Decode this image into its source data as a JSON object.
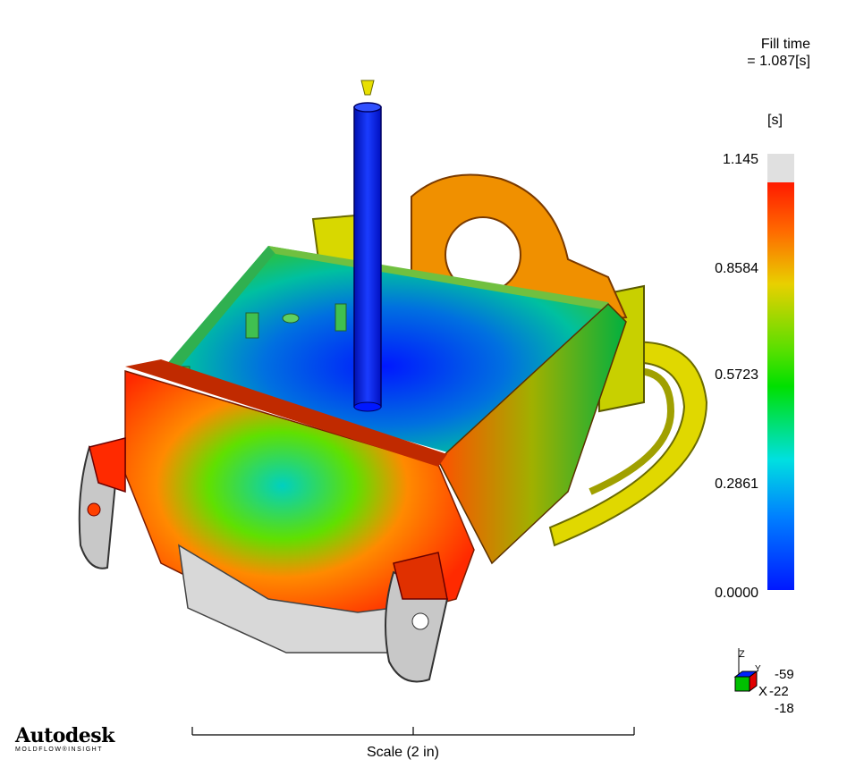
{
  "result": {
    "title_line1": "Fill time",
    "title_line2": "= 1.087[s]"
  },
  "color_scale": {
    "unit": "[s]",
    "max_label": "1.145",
    "ticks": [
      "0.8584",
      "0.5723",
      "0.2861",
      "0.0000"
    ],
    "colors": {
      "top_gray": "#e0e0e0",
      "red": "#ff1a00",
      "orange": "#ff8a00",
      "yellow": "#e0e000",
      "green": "#00d020",
      "cyan": "#00e0e0",
      "blue": "#0018ff"
    }
  },
  "orientation": {
    "axis_z": "Z",
    "axis_y": "Y",
    "axis_x": "X",
    "values": [
      "-59",
      "-22",
      "-18"
    ]
  },
  "scale": {
    "caption": "Scale (2 in)"
  },
  "brand": {
    "name": "Autodesk",
    "tagline": "MOLDFLOW®INSIGHT"
  }
}
